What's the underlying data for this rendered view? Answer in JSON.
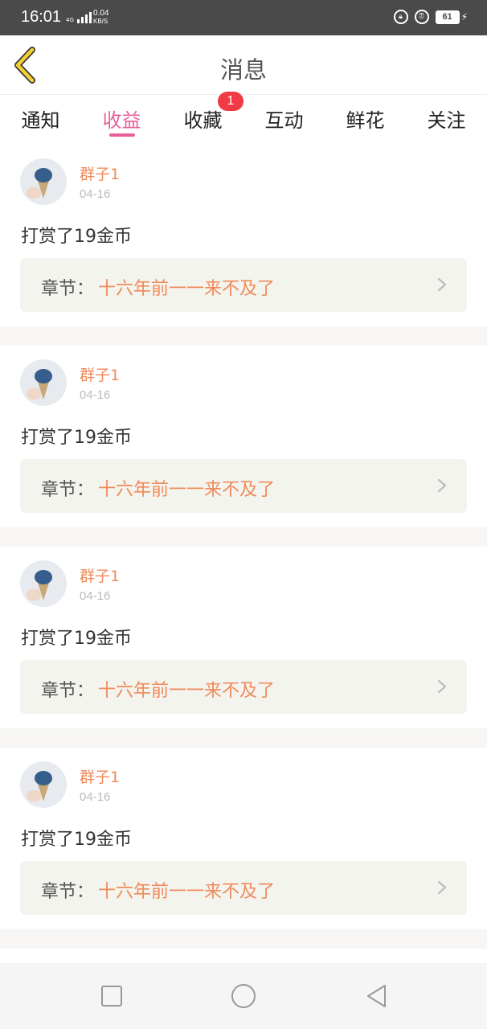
{
  "status_bar": {
    "time": "16:01",
    "network_type": "4G",
    "speed_value": "0.04",
    "speed_unit": "KB/S",
    "battery": "61"
  },
  "header": {
    "title": "消息"
  },
  "tabs": [
    {
      "label": "通知",
      "active": false
    },
    {
      "label": "收益",
      "active": true
    },
    {
      "label": "收藏",
      "active": false,
      "badge": "1"
    },
    {
      "label": "互动",
      "active": false
    },
    {
      "label": "鲜花",
      "active": false
    },
    {
      "label": "关注",
      "active": false
    }
  ],
  "messages": [
    {
      "user": "群子1",
      "date": "04-16",
      "text": "打赏了19金币",
      "chapter_label": "章节：",
      "chapter_title": "十六年前一一来不及了"
    },
    {
      "user": "群子1",
      "date": "04-16",
      "text": "打赏了19金币",
      "chapter_label": "章节：",
      "chapter_title": "十六年前一一来不及了"
    },
    {
      "user": "群子1",
      "date": "04-16",
      "text": "打赏了19金币",
      "chapter_label": "章节：",
      "chapter_title": "十六年前一一来不及了"
    },
    {
      "user": "群子1",
      "date": "04-16",
      "text": "打赏了19金币",
      "chapter_label": "章节：",
      "chapter_title": "十六年前一一来不及了"
    }
  ],
  "colors": {
    "accent_pink": "#e8609a",
    "accent_orange": "#f08a5a",
    "back_arrow": "#f5d032",
    "badge_red": "#f03a45"
  },
  "icons": {
    "back": "back-arrow-icon",
    "chapter_arrow": "chevron-right-icon",
    "nav_recent": "square-icon",
    "nav_home": "circle-icon",
    "nav_back": "triangle-back-icon"
  }
}
